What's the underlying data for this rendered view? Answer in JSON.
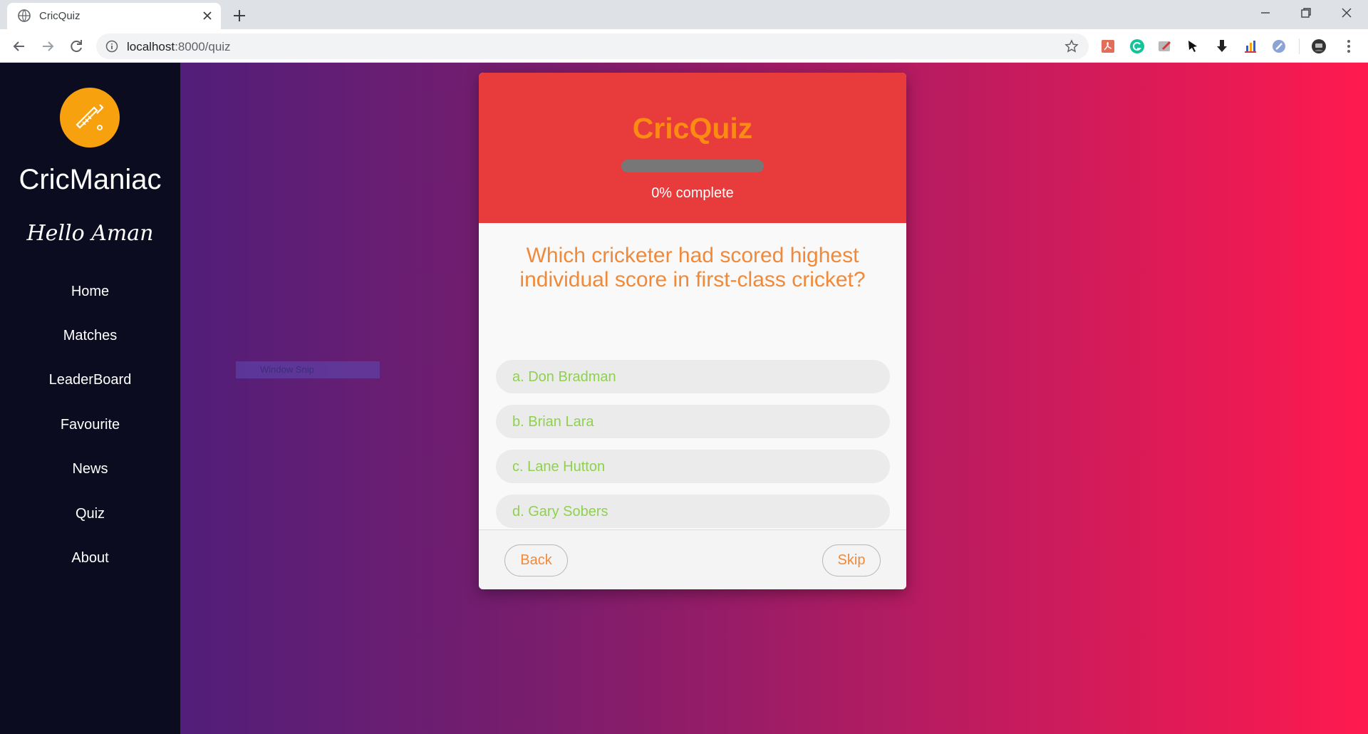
{
  "browser": {
    "tab_title": "CricQuiz",
    "url_host": "localhost",
    "url_path": ":8000/quiz"
  },
  "sidebar": {
    "brand": "CricManiac",
    "greeting": "Hello Aman",
    "nav": [
      "Home",
      "Matches",
      "LeaderBoard",
      "Favourite",
      "News",
      "Quiz",
      "About"
    ]
  },
  "overlay": {
    "label": "Window Snip"
  },
  "quiz": {
    "title": "CricQuiz",
    "progress_percent": 0,
    "progress_text": "0% complete",
    "question": "Which cricketer had scored highest individual score in first-class cricket?",
    "options": [
      "a. Don Bradman",
      "b. Brian Lara",
      "c. Lane Hutton",
      "d. Gary Sobers"
    ],
    "back_label": "Back",
    "skip_label": "Skip"
  },
  "colors": {
    "sidebar_bg": "#0c0c20",
    "logo_bg": "#f7a10e",
    "card_head_bg": "#e83b3c",
    "title_color": "#fb8b12",
    "question_color": "#f08a3a",
    "option_text_color": "#8fd14f",
    "gradient_start": "#3d1f7f",
    "gradient_end": "#ff1a4e"
  }
}
